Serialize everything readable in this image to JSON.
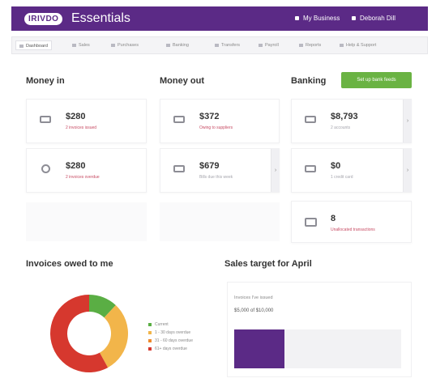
{
  "header": {
    "brand": "IRIVDO",
    "product": "Essentials",
    "links": [
      "My Business",
      "Deborah Dill"
    ]
  },
  "nav": {
    "items": [
      {
        "label": "Dashboard",
        "active": true
      },
      {
        "label": "Sales",
        "active": false
      },
      {
        "label": "Purchases",
        "active": false
      },
      {
        "label": "Banking",
        "active": false
      },
      {
        "label": "Transfers",
        "active": false
      },
      {
        "label": "Payroll",
        "active": false
      },
      {
        "label": "Reports",
        "active": false
      },
      {
        "label": "Help & Support",
        "active": false
      }
    ]
  },
  "money_in": {
    "title": "Money in",
    "cards": [
      {
        "icon": "invoice-icon",
        "value": "$280",
        "subtitle": "2 invoices issued"
      },
      {
        "icon": "clock-icon",
        "value": "$280",
        "subtitle": "2 invoices overdue"
      }
    ]
  },
  "money_out": {
    "title": "Money out",
    "cards": [
      {
        "icon": "bill-icon",
        "value": "$372",
        "subtitle": "Owing to suppliers"
      },
      {
        "icon": "bill-icon",
        "value": "$679",
        "subtitle": "Bills due this week"
      }
    ]
  },
  "banking": {
    "title": "Banking",
    "add_button": "Set up bank feeds",
    "cards": [
      {
        "icon": "bank-icon",
        "value": "$8,793",
        "subtitle": "2 accounts"
      },
      {
        "icon": "card-icon",
        "value": "$0",
        "subtitle": "1 credit card"
      },
      {
        "icon": "monitor-icon",
        "value": "8",
        "subtitle": "Unallocated transactions"
      }
    ]
  },
  "invoices_owed": {
    "title": "Invoices owed to me",
    "legend": [
      {
        "label": "Current",
        "color": "#5aae44"
      },
      {
        "label": "1 - 30 days overdue",
        "color": "#f2b54a"
      },
      {
        "label": "31 - 60 days overdue",
        "color": "#ee8a2c"
      },
      {
        "label": "61+ days overdue",
        "color": "#d6382e"
      }
    ]
  },
  "sales_target": {
    "title": "Sales target for April",
    "label": "Invoices I've issued",
    "value": "$5,000 of $10,000",
    "progress": 0.3
  },
  "chart_data": {
    "type": "pie",
    "categories": [
      "Current",
      "1 - 30 days overdue",
      "31 - 60 days overdue",
      "61+ days overdue"
    ],
    "values": [
      12,
      30,
      0,
      58
    ],
    "colors": [
      "#5aae44",
      "#f2b54a",
      "#ee8a2c",
      "#d6382e"
    ],
    "donut": true,
    "title": "Invoices owed to me"
  }
}
